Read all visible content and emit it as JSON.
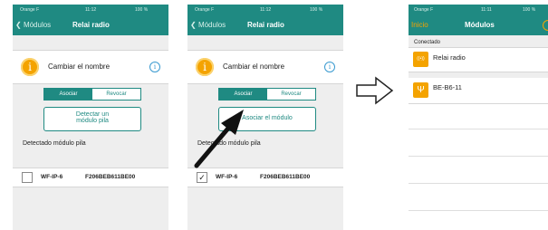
{
  "accent_color": "#1f8a82",
  "icon_color": "#f4a300",
  "screen1": {
    "status": {
      "carrier": "Orange F",
      "time": "11:12",
      "battery": "100 %"
    },
    "nav": {
      "back": "Módulos",
      "title": "Relai radio"
    },
    "rename_label": "Cambiar el nombre",
    "segmented": {
      "left": "Asociar",
      "right": "Revocar",
      "selected": "Asociar"
    },
    "action_button": {
      "line1": "Detectar un",
      "line2": "módulo pila"
    },
    "detected_label": "Detectado módulo pila",
    "device": {
      "id": "WF-IP-6",
      "serial": "F206BEB611BE00",
      "checked": false
    }
  },
  "screen2": {
    "status": {
      "carrier": "Orange F",
      "time": "11:12",
      "battery": "100 %"
    },
    "nav": {
      "back": "Módulos",
      "title": "Relai radio"
    },
    "rename_label": "Cambiar el nombre",
    "segmented": {
      "left": "Asociar",
      "right": "Revocar",
      "selected": "Asociar"
    },
    "action_button": {
      "label": "Asociar el módulo"
    },
    "detected_label": "Detectado módulo pila",
    "device": {
      "id": "WF-IP-6",
      "serial": "F206BEB611BE00",
      "checked": true,
      "check_glyph": "✓"
    }
  },
  "screen3": {
    "status": {
      "carrier": "Orange F",
      "time": "11:11",
      "battery": "100 %"
    },
    "nav": {
      "back": "Inicio",
      "title": "Módulos"
    },
    "section_header": "Conectado",
    "modules": [
      {
        "label": "Relai radio",
        "icon": "radio-waves-icon",
        "icon_text": "((•))"
      },
      {
        "label": "BE-B6-11",
        "icon": "antenna-icon",
        "icon_text": "Ψ"
      }
    ]
  },
  "info_glyph": "i",
  "info_button_glyph": "i"
}
